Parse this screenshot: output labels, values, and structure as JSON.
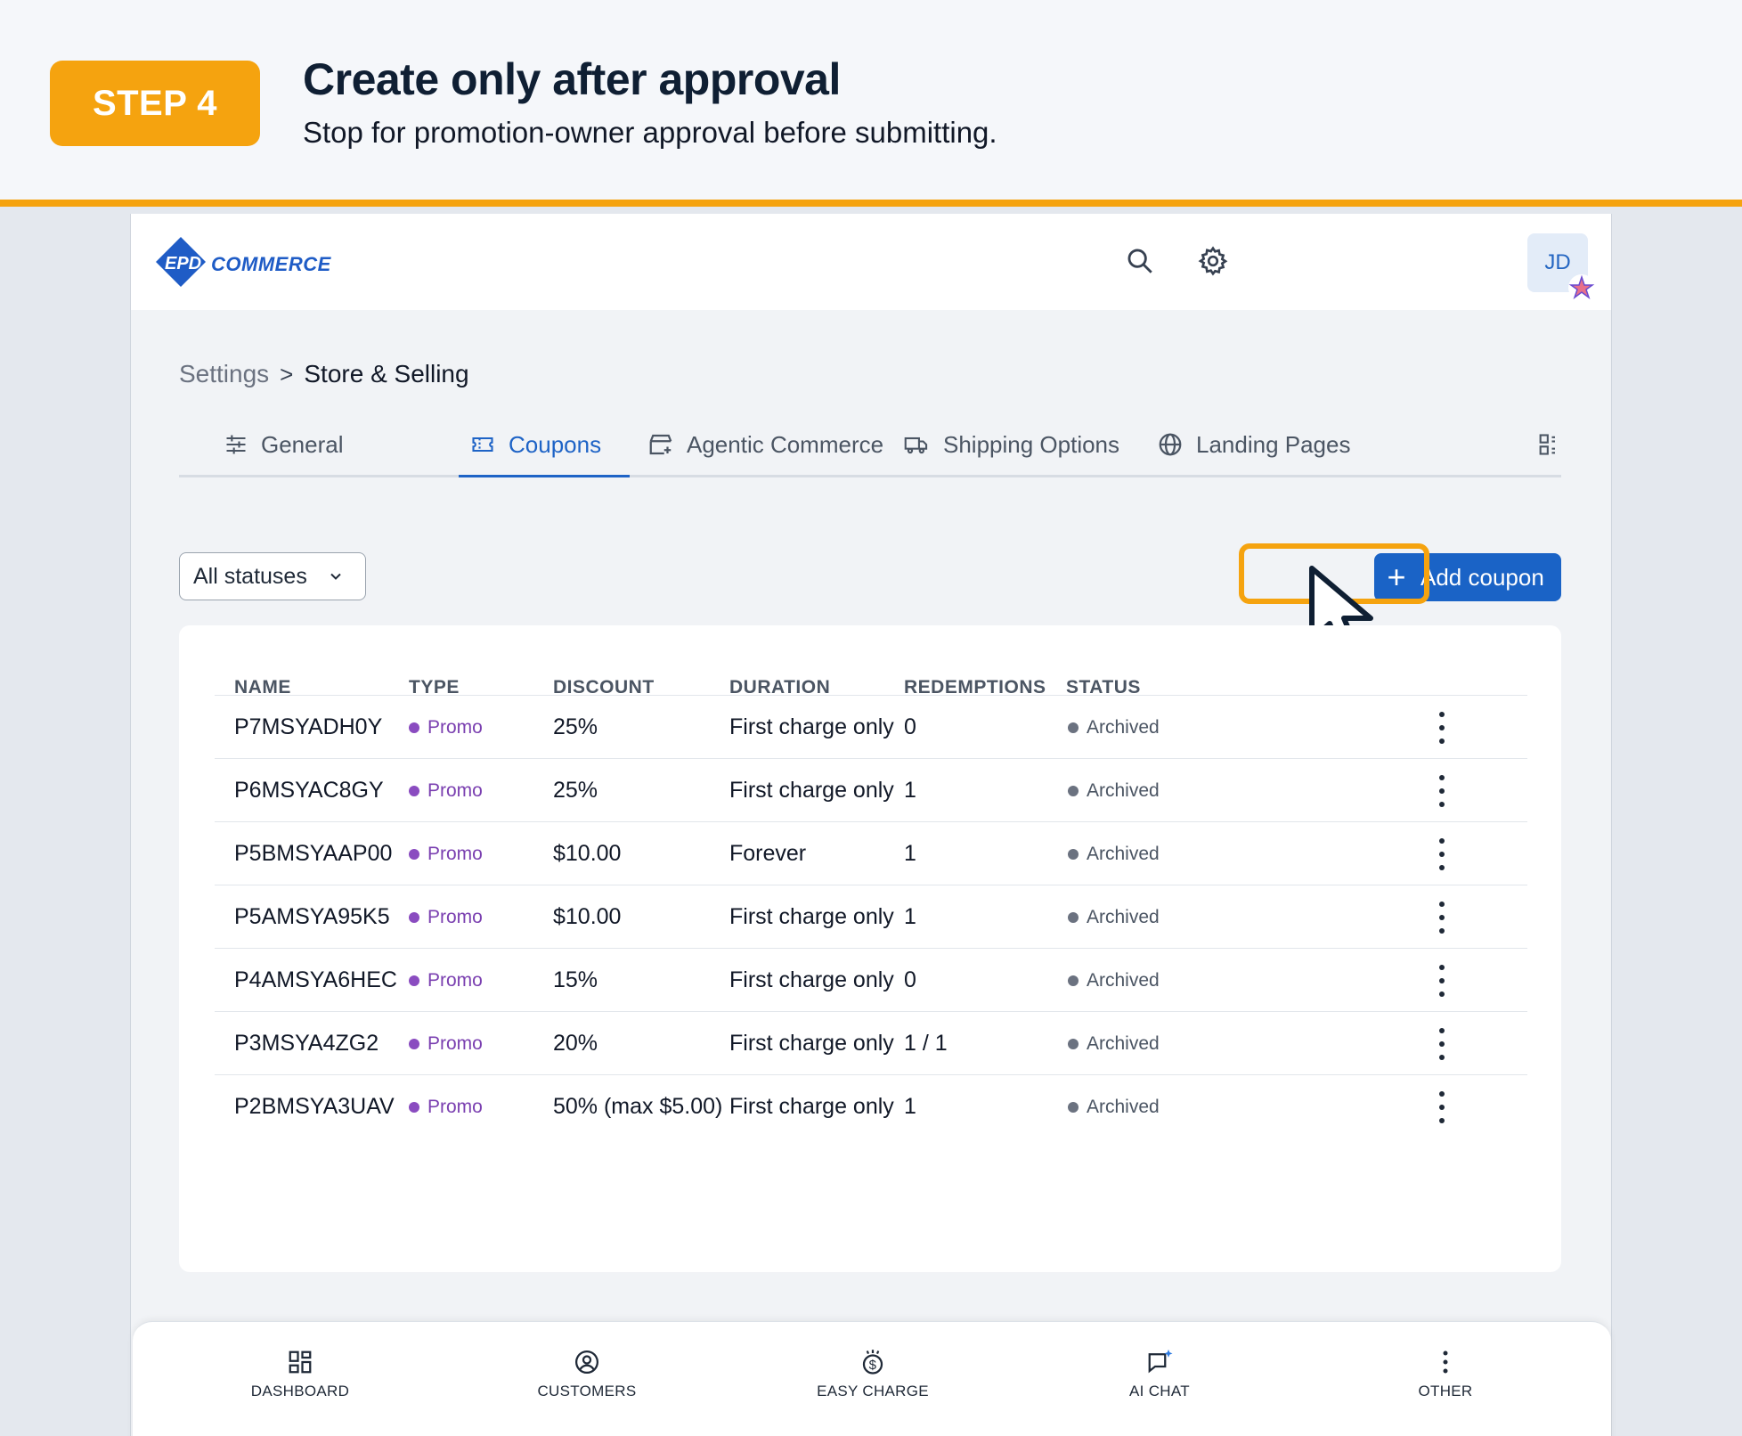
{
  "banner": {
    "step": "STEP 4",
    "title": "Create only after approval",
    "subtitle": "Stop for promotion-owner approval before submitting."
  },
  "app": {
    "brand_text": "COMMERCE",
    "brand_mark": "EPD",
    "avatar_initials": "JD",
    "icons": [
      "search-icon",
      "gear-icon"
    ]
  },
  "breadcrumb": {
    "root": "Settings",
    "separator": ">",
    "current": "Store & Selling"
  },
  "tabs": [
    {
      "label": "General",
      "icon": "sliders-icon"
    },
    {
      "label": "Coupons",
      "icon": "ticket-icon",
      "active": true
    },
    {
      "label": "Agentic Commerce",
      "icon": "storefront-icon"
    },
    {
      "label": "Shipping Options",
      "icon": "truck-icon"
    },
    {
      "label": "Landing Pages",
      "icon": "globe-icon"
    }
  ],
  "filter": {
    "selected": "All statuses"
  },
  "actions": {
    "add_coupon": "Add coupon",
    "add_icon": "+"
  },
  "table": {
    "headers": [
      "NAME",
      "TYPE",
      "DISCOUNT",
      "DURATION",
      "REDEMPTIONS",
      "STATUS"
    ],
    "rows": [
      {
        "name": "P7MSYADH0Y",
        "type": "Promo",
        "discount": "25%",
        "duration": "First charge only",
        "redemptions": "0",
        "status": "Archived"
      },
      {
        "name": "P6MSYAC8GY",
        "type": "Promo",
        "discount": "25%",
        "duration": "First charge only",
        "redemptions": "1",
        "status": "Archived"
      },
      {
        "name": "P5BMSYAAP00",
        "type": "Promo",
        "discount": "$10.00",
        "duration": "Forever",
        "redemptions": "1",
        "status": "Archived"
      },
      {
        "name": "P5AMSYA95K5",
        "type": "Promo",
        "discount": "$10.00",
        "duration": "First charge only",
        "redemptions": "1",
        "status": "Archived"
      },
      {
        "name": "P4AMSYA6HEC",
        "type": "Promo",
        "discount": "15%",
        "duration": "First charge only",
        "redemptions": "0",
        "status": "Archived"
      },
      {
        "name": "P3MSYA4ZG2",
        "type": "Promo",
        "discount": "20%",
        "duration": "First charge only",
        "redemptions": "1 / 1",
        "status": "Archived"
      },
      {
        "name": "P2BMSYA3UAV",
        "type": "Promo",
        "discount": "50% (max $5.00)",
        "duration": "First charge only",
        "redemptions": "1",
        "status": "Archived"
      }
    ]
  },
  "bottom_nav": [
    {
      "label": "DASHBOARD",
      "icon": "dashboard-icon"
    },
    {
      "label": "CUSTOMERS",
      "icon": "customer-icon"
    },
    {
      "label": "EASY CHARGE",
      "icon": "dollar-icon"
    },
    {
      "label": "AI CHAT",
      "icon": "chat-icon"
    },
    {
      "label": "OTHER",
      "icon": "more-icon"
    }
  ],
  "colors": {
    "accent_orange": "#f5a30f",
    "primary_blue": "#1a63c6",
    "promo_purple": "#7a3fb0"
  }
}
